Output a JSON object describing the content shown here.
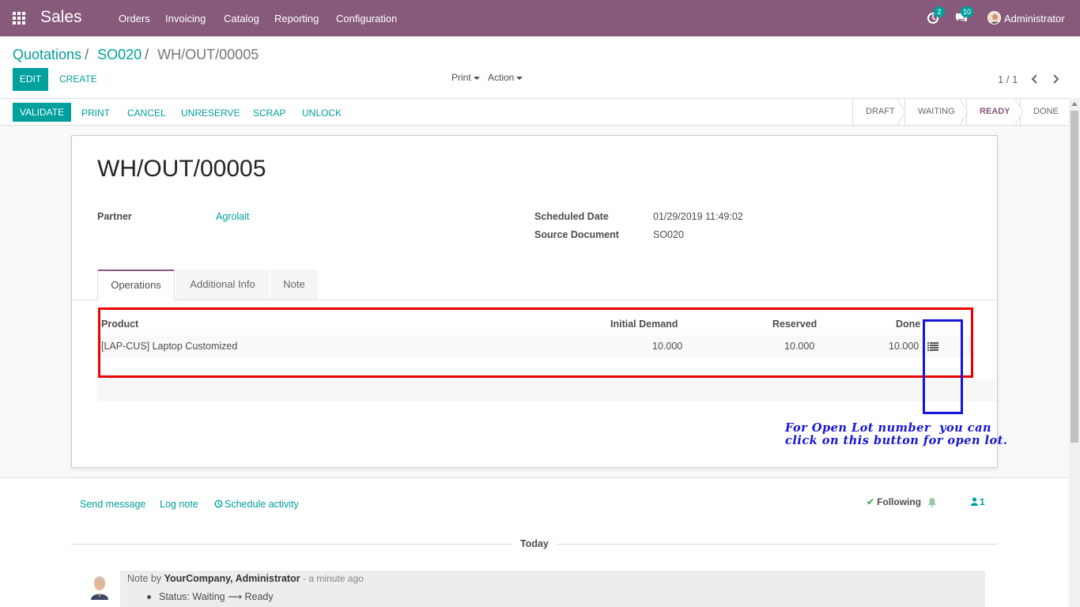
{
  "app": {
    "title": "Sales"
  },
  "menu": [
    "Orders",
    "Invoicing",
    "Catalog",
    "Reporting",
    "Configuration"
  ],
  "systray": {
    "activity_count": "2",
    "message_count": "10",
    "user_name": "Administrator"
  },
  "breadcrumb": {
    "items": [
      "Quotations",
      "SO020"
    ],
    "current": "WH/OUT/00005"
  },
  "controls": {
    "edit": "EDIT",
    "create": "CREATE",
    "print": "Print",
    "action": "Action",
    "pager": "1 / 1"
  },
  "statusbar": {
    "buttons": [
      "VALIDATE",
      "PRINT",
      "CANCEL",
      "UNRESERVE",
      "SCRAP",
      "UNLOCK"
    ],
    "stages": [
      "DRAFT",
      "WAITING",
      "READY",
      "DONE"
    ],
    "current_stage": "READY"
  },
  "record": {
    "name": "WH/OUT/00005",
    "partner_label": "Partner",
    "partner_value": "Agrolait",
    "scheduled_label": "Scheduled Date",
    "scheduled_value": "01/29/2019 11:49:02",
    "source_label": "Source Document",
    "source_value": "SO020"
  },
  "tabs": [
    "Operations",
    "Additional Info",
    "Note"
  ],
  "operations": {
    "headers": [
      "Product",
      "Initial Demand",
      "Reserved",
      "Done"
    ],
    "rows": [
      {
        "product": "[LAP-CUS] Laptop Customized",
        "initial_demand": "10.000",
        "reserved": "10.000",
        "done": "10.000"
      }
    ]
  },
  "annotation": {
    "text": "For Open Lot number  you can\nclick on this button for open lot."
  },
  "chatter": {
    "send_message": "Send message",
    "log_note": "Log note",
    "schedule_activity": "Schedule activity",
    "following": "Following",
    "followers_count": "1",
    "today": "Today",
    "message": {
      "prefix": "Note by",
      "author": "YourCompany, Administrator",
      "ago": "- a minute ago",
      "tracking": "Status: Waiting ⟶ Ready"
    }
  },
  "colors": {
    "brand": "#875a7b",
    "accent": "#00a09d",
    "annotation_red": "#ee0000",
    "annotation_blue": "#1414d8"
  }
}
